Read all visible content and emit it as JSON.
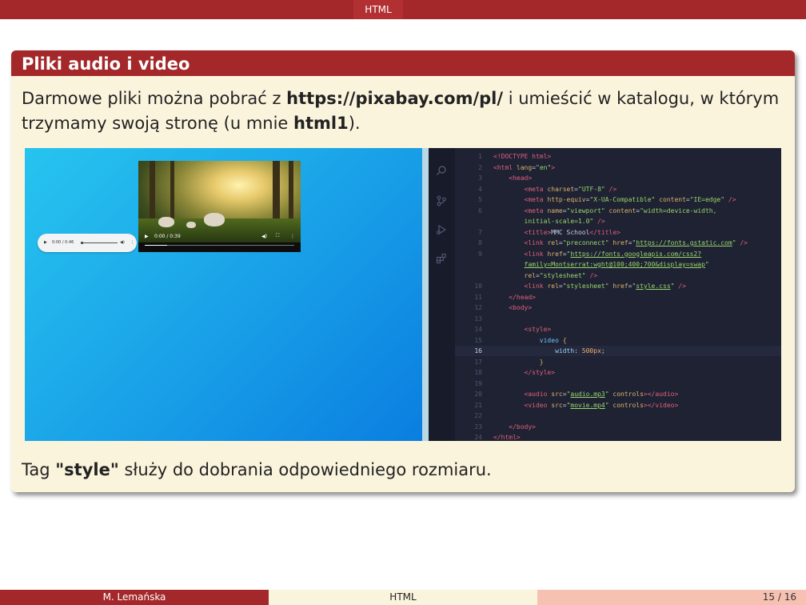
{
  "header": {
    "section": "HTML"
  },
  "block": {
    "title": "Pliki audio i video",
    "para": {
      "t1": "Darmowe pliki można pobrać z ",
      "url": "https://pixabay.com/pl/",
      "t2": " i umieścić w katalogu, w którym trzymamy swoją stronę (u mnie ",
      "dir": "html1",
      "t3": ")."
    },
    "caption": {
      "t1": "Tag ",
      "tag": "\"style\"",
      "t2": " służy do dobrania odpowiedniego rozmiaru."
    }
  },
  "screenshot": {
    "audio_player": {
      "time": "0:00 / 0:46"
    },
    "video_player": {
      "time": "0:00 / 0:39"
    },
    "code_lines": [
      {
        "n": "1",
        "html": "<span class=\"t\">&lt;!DOCTYPE html&gt;</span>"
      },
      {
        "n": "2",
        "html": "<span class=\"t\">&lt;html</span> <span class=\"a\">lang</span>=<span class=\"v\">\"en\"</span><span class=\"t\">&gt;</span>"
      },
      {
        "n": "3",
        "html": "&nbsp;&nbsp;&nbsp;&nbsp;<span class=\"t\">&lt;head&gt;</span>"
      },
      {
        "n": "4",
        "html": "&nbsp;&nbsp;&nbsp;&nbsp;&nbsp;&nbsp;&nbsp;&nbsp;<span class=\"t\">&lt;meta</span> <span class=\"a\">charset</span>=<span class=\"v\">\"UTF-8\"</span> <span class=\"t\">/&gt;</span>"
      },
      {
        "n": "5",
        "html": "&nbsp;&nbsp;&nbsp;&nbsp;&nbsp;&nbsp;&nbsp;&nbsp;<span class=\"t\">&lt;meta</span> <span class=\"a\">http-equiv</span>=<span class=\"v\">\"X-UA-Compatible\"</span> <span class=\"a\">content</span>=<span class=\"v\">\"IE=edge\"</span> <span class=\"t\">/&gt;</span>"
      },
      {
        "n": "6",
        "html": "&nbsp;&nbsp;&nbsp;&nbsp;&nbsp;&nbsp;&nbsp;&nbsp;<span class=\"t\">&lt;meta</span> <span class=\"a\">name</span>=<span class=\"v\">\"viewport\"</span> <span class=\"a\">content</span>=<span class=\"v\">\"width=device-width,</span>"
      },
      {
        "n": "",
        "html": "&nbsp;&nbsp;&nbsp;&nbsp;&nbsp;&nbsp;&nbsp;&nbsp;<span class=\"v\">initial-scale=1.0\"</span> <span class=\"t\">/&gt;</span>"
      },
      {
        "n": "7",
        "html": "&nbsp;&nbsp;&nbsp;&nbsp;&nbsp;&nbsp;&nbsp;&nbsp;<span class=\"t\">&lt;title&gt;</span>MMC School<span class=\"t\">&lt;/title&gt;</span>"
      },
      {
        "n": "8",
        "html": "&nbsp;&nbsp;&nbsp;&nbsp;&nbsp;&nbsp;&nbsp;&nbsp;<span class=\"t\">&lt;link</span> <span class=\"a\">rel</span>=<span class=\"v\">\"preconnect\"</span> <span class=\"a\">href</span>=<span class=\"v\">\"</span><span class=\"lnk\">https://fonts.gstatic.com</span><span class=\"v\">\"</span> <span class=\"t\">/&gt;</span>"
      },
      {
        "n": "9",
        "html": "&nbsp;&nbsp;&nbsp;&nbsp;&nbsp;&nbsp;&nbsp;&nbsp;<span class=\"t\">&lt;link</span> <span class=\"a\">href</span>=<span class=\"v\">\"</span><span class=\"lnk\">https://fonts.googleapis.com/css2?</span>"
      },
      {
        "n": "",
        "html": "&nbsp;&nbsp;&nbsp;&nbsp;&nbsp;&nbsp;&nbsp;&nbsp;<span class=\"lnk\">family=Montserrat:wght@100;400;700&amp;display=swap</span><span class=\"v\">\"</span>"
      },
      {
        "n": "",
        "html": "&nbsp;&nbsp;&nbsp;&nbsp;&nbsp;&nbsp;&nbsp;&nbsp;<span class=\"a\">rel</span>=<span class=\"v\">\"stylesheet\"</span> <span class=\"t\">/&gt;</span>"
      },
      {
        "n": "10",
        "html": "&nbsp;&nbsp;&nbsp;&nbsp;&nbsp;&nbsp;&nbsp;&nbsp;<span class=\"t\">&lt;link</span> <span class=\"a\">rel</span>=<span class=\"v\">\"stylesheet\"</span> <span class=\"a\">href</span>=<span class=\"v\">\"</span><span class=\"lnk\">style.css</span><span class=\"v\">\"</span> <span class=\"t\">/&gt;</span>"
      },
      {
        "n": "11",
        "html": "&nbsp;&nbsp;&nbsp;&nbsp;<span class=\"t\">&lt;/head&gt;</span>"
      },
      {
        "n": "12",
        "html": "&nbsp;&nbsp;&nbsp;&nbsp;<span class=\"t\">&lt;body&gt;</span>"
      },
      {
        "n": "13",
        "html": ""
      },
      {
        "n": "14",
        "html": "&nbsp;&nbsp;&nbsp;&nbsp;&nbsp;&nbsp;&nbsp;&nbsp;<span class=\"t\">&lt;style&gt;</span>"
      },
      {
        "n": "15",
        "html": "&nbsp;&nbsp;&nbsp;&nbsp;&nbsp;&nbsp;&nbsp;&nbsp;&nbsp;&nbsp;&nbsp;&nbsp;<span style=\"color:#6fc3ff\">video</span> <span class=\"a\">{</span>"
      },
      {
        "n": "16",
        "html": "&nbsp;&nbsp;&nbsp;&nbsp;&nbsp;&nbsp;&nbsp;&nbsp;&nbsp;&nbsp;&nbsp;&nbsp;&nbsp;&nbsp;&nbsp;&nbsp;<span style=\"color:#8fd4f0\">width</span>: <span style=\"color:#f0b070\">500px</span>;"
      },
      {
        "n": "17",
        "html": "&nbsp;&nbsp;&nbsp;&nbsp;&nbsp;&nbsp;&nbsp;&nbsp;&nbsp;&nbsp;&nbsp;&nbsp;<span class=\"a\">}</span>"
      },
      {
        "n": "18",
        "html": "&nbsp;&nbsp;&nbsp;&nbsp;&nbsp;&nbsp;&nbsp;&nbsp;<span class=\"t\">&lt;/style&gt;</span>"
      },
      {
        "n": "19",
        "html": ""
      },
      {
        "n": "20",
        "html": "&nbsp;&nbsp;&nbsp;&nbsp;&nbsp;&nbsp;&nbsp;&nbsp;<span class=\"t\">&lt;audio</span> <span class=\"a\">src</span>=<span class=\"v\">\"</span><span class=\"lnk\">audio.mp3</span><span class=\"v\">\"</span> <span class=\"a\">controls</span><span class=\"t\">&gt;&lt;/audio&gt;</span>"
      },
      {
        "n": "21",
        "html": "&nbsp;&nbsp;&nbsp;&nbsp;&nbsp;&nbsp;&nbsp;&nbsp;<span class=\"t\">&lt;video</span> <span class=\"a\">src</span>=<span class=\"v\">\"</span><span class=\"lnk\">movie.mp4</span><span class=\"v\">\"</span> <span class=\"a\">controls</span><span class=\"t\">&gt;&lt;/video&gt;</span>"
      },
      {
        "n": "22",
        "html": ""
      },
      {
        "n": "23",
        "html": "&nbsp;&nbsp;&nbsp;&nbsp;<span class=\"t\">&lt;/body&gt;</span>"
      },
      {
        "n": "24",
        "html": "<span class=\"t\">&lt;/html&gt;</span>"
      }
    ],
    "highlight_line": "16"
  },
  "footer": {
    "author": "M. Lemańska",
    "title": "HTML",
    "page": "15 / 16"
  },
  "colors": {
    "accent": "#a4282a",
    "block_bg": "#fbf4dd",
    "footer_right": "#f6c1b1"
  }
}
